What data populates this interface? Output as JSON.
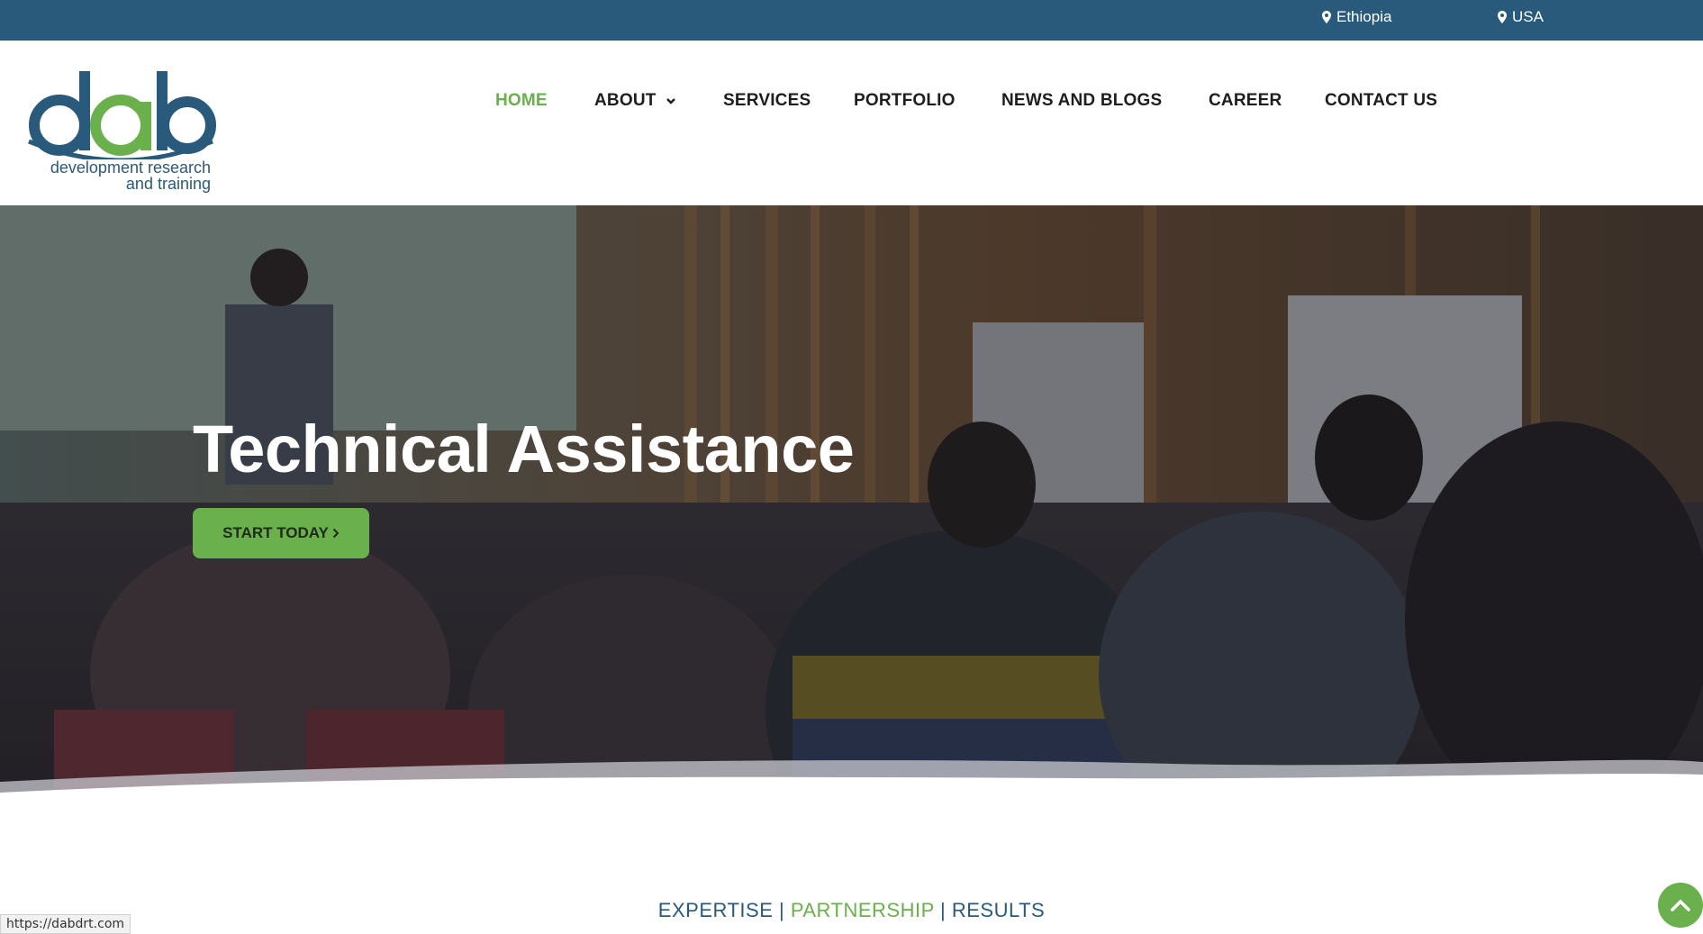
{
  "topbar": {
    "locations": [
      {
        "label": "Ethiopia",
        "icon": "map-marker-icon"
      },
      {
        "label": "USA",
        "icon": "map-marker-icon"
      }
    ]
  },
  "logo": {
    "wordmark": "dab",
    "tagline_line1": "development research",
    "tagline_line2": "and training"
  },
  "nav": {
    "items": [
      {
        "label": "HOME",
        "active": true
      },
      {
        "label": "ABOUT",
        "has_dropdown": true
      },
      {
        "label": "SERVICES"
      },
      {
        "label": "PORTFOLIO"
      },
      {
        "label": "NEWS AND BLOGS"
      },
      {
        "label": "CAREER"
      },
      {
        "label": "CONTACT US"
      }
    ]
  },
  "hero": {
    "title": "Technical Assistance",
    "cta_label": "START TODAY",
    "cta_icon": "chevron-right-icon"
  },
  "tagline": {
    "part1": "EXPERTISE",
    "sep1": " | ",
    "part2": "PARTNERSHIP",
    "sep2": " | ",
    "part3": "RESULTS"
  },
  "status_bar": {
    "url": "https://dabdrt.com"
  },
  "colors": {
    "brand_blue": "#2a5a7b",
    "brand_green": "#6ab04c",
    "text_dark": "#1e1e1e"
  }
}
